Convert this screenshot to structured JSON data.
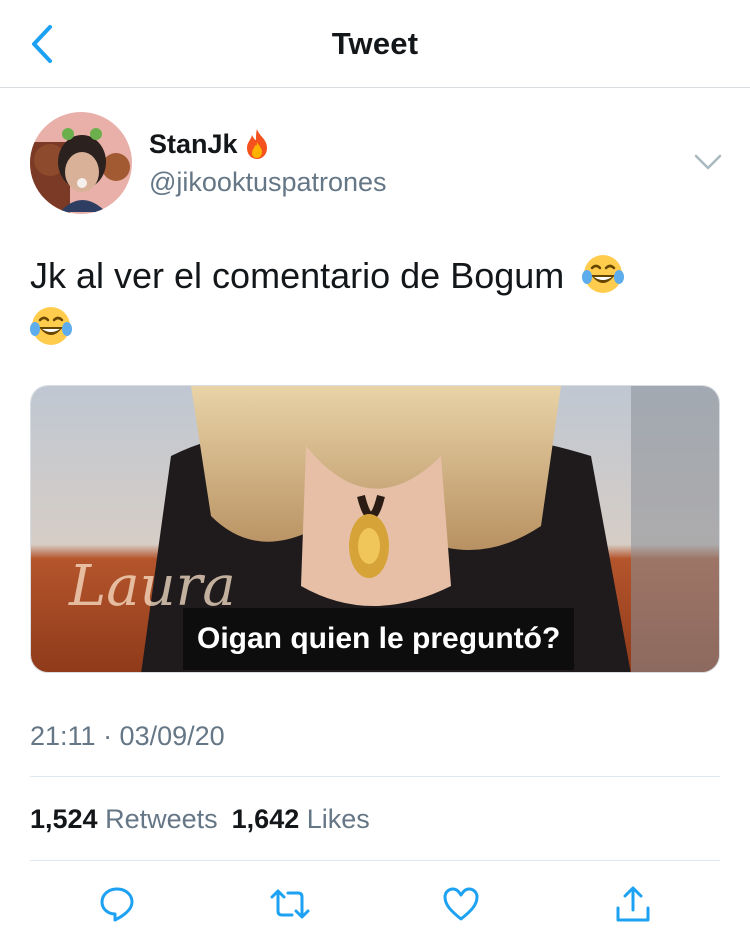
{
  "nav": {
    "back_icon": "chevron-left-icon",
    "title": "Tweet"
  },
  "tweet": {
    "author": {
      "name": "StanJk",
      "name_emoji": "fire-icon",
      "handle": "@jikooktuspatrones"
    },
    "text": "Jk al ver el comentario de Bogum",
    "text_emojis": [
      "face-with-tears-of-joy-icon",
      "face-with-tears-of-joy-icon"
    ],
    "media": {
      "logo_text": "Laura",
      "subtitle": "Oigan quien le preguntó?"
    },
    "timestamp": "21:11 · 03/09/20",
    "stats": {
      "retweets_count": "1,524",
      "retweets_label": "Retweets",
      "likes_count": "1,642",
      "likes_label": "Likes"
    }
  },
  "actions": [
    "reply-icon",
    "retweet-icon",
    "like-icon",
    "share-icon"
  ],
  "colors": {
    "accent": "#1da1f2",
    "secondary_text": "#657786",
    "divider": "#e1e8ed"
  }
}
